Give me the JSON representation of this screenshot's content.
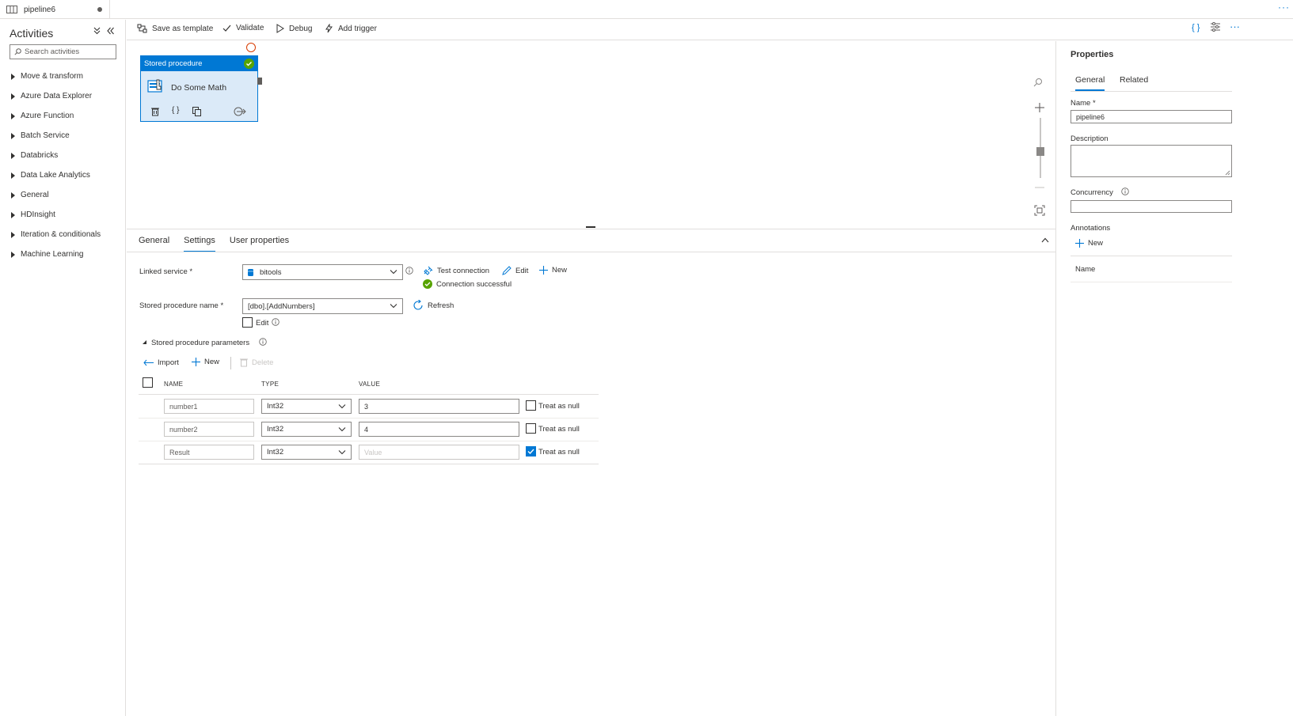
{
  "tab": {
    "title": "pipeline6"
  },
  "activities": {
    "title": "Activities",
    "search_placeholder": "Search activities",
    "categories": [
      "Move & transform",
      "Azure Data Explorer",
      "Azure Function",
      "Batch Service",
      "Databricks",
      "Data Lake Analytics",
      "General",
      "HDInsight",
      "Iteration & conditionals",
      "Machine Learning"
    ]
  },
  "toolbar": {
    "save_template": "Save as template",
    "validate": "Validate",
    "debug": "Debug",
    "add_trigger": "Add trigger"
  },
  "canvas": {
    "activity_type": "Stored procedure",
    "activity_name": "Do Some Math"
  },
  "panel": {
    "tabs": [
      "General",
      "Settings",
      "User properties"
    ],
    "active_tab": "Settings",
    "linked_service_label": "Linked service",
    "required_mark": "*",
    "linked_service_value": "bitools",
    "test_connection": "Test connection",
    "edit": "Edit",
    "new": "New",
    "connection_status": "Connection successful",
    "sp_name_label": "Stored procedure name",
    "sp_name_value": "[dbo].[AddNumbers]",
    "refresh": "Refresh",
    "sp_edit_label": "Edit",
    "params_label": "Stored procedure parameters",
    "import": "Import",
    "params_new": "New",
    "delete": "Delete",
    "columns": {
      "name": "NAME",
      "type": "TYPE",
      "value": "VALUE"
    },
    "treat_as_null": "Treat as null",
    "value_placeholder": "Value",
    "params": [
      {
        "name": "number1",
        "type": "Int32",
        "value": "3",
        "treat_null": false
      },
      {
        "name": "number2",
        "type": "Int32",
        "value": "4",
        "treat_null": false
      },
      {
        "name": "Result",
        "type": "Int32",
        "value": "",
        "treat_null": true
      }
    ]
  },
  "properties": {
    "title": "Properties",
    "tabs": [
      "General",
      "Related"
    ],
    "name_label": "Name",
    "required_mark": "*",
    "name_value": "pipeline6",
    "description_label": "Description",
    "concurrency_label": "Concurrency",
    "annotations_label": "Annotations",
    "annotations_new": "New",
    "annotations_col": "Name"
  },
  "colors": {
    "accent": "#0078d4",
    "success": "#57a300",
    "border": "#8a8886"
  }
}
